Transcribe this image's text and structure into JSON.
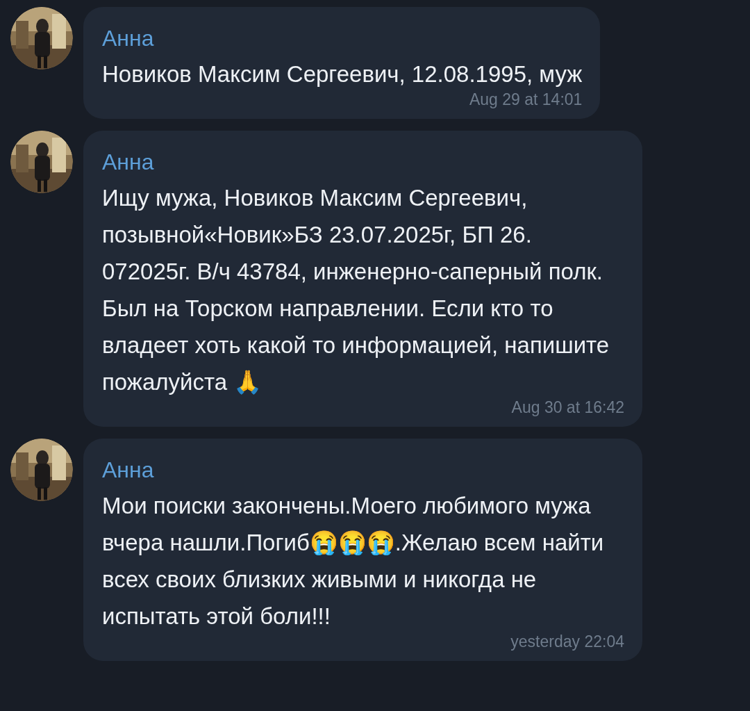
{
  "messages": [
    {
      "sender": "Анна",
      "text": "Новиков Максим Сергеевич, 12.08.1995, муж",
      "time": "Aug 29 at 14:01"
    },
    {
      "sender": "Анна",
      "text": "Ищу мужа, Новиков Максим Сергеевич, позывной«Новик»БЗ 23.07.2025г, БП 26. 072025г. В/ч 43784, инженерно-саперный полк. Был на Торском направлении. Если кто то владеет хоть какой то информацией, напишите пожалуйста 🙏",
      "time": "Aug 30 at 16:42"
    },
    {
      "sender": "Анна",
      "text": "Мои поиски закончены.Моего любимого мужа вчера нашли.Погиб😭😭😭.Желаю всем найти всех своих близких живыми и никогда не испытать этой боли!!!",
      "time": "yesterday 22:04"
    }
  ]
}
